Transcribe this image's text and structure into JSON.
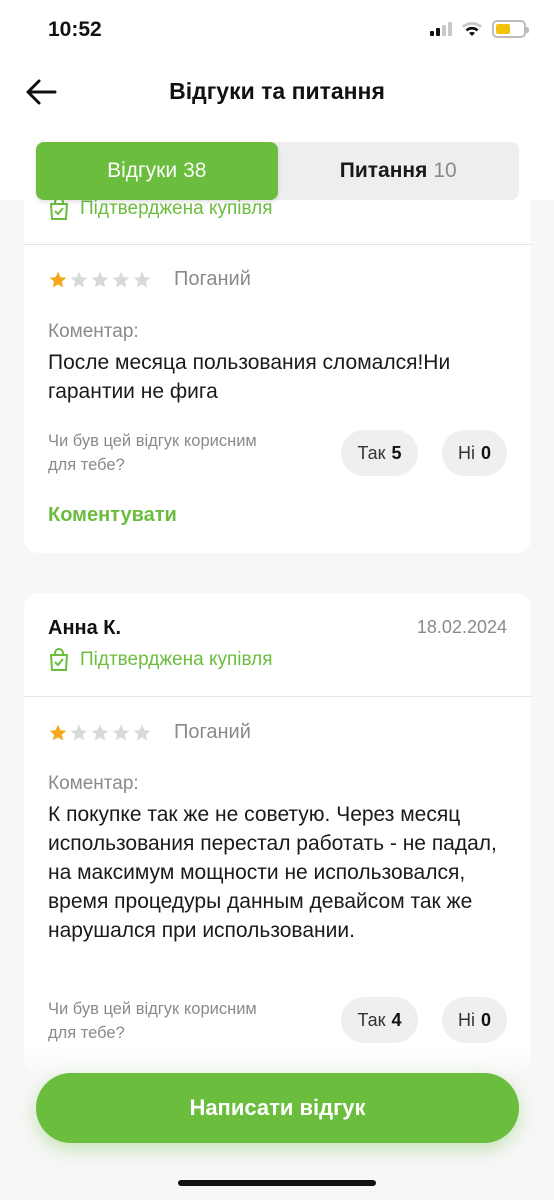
{
  "status": {
    "time": "10:52"
  },
  "header": {
    "title": "Відгуки та питання",
    "tabs": [
      {
        "label": "Відгуки",
        "count": "38",
        "active": true
      },
      {
        "label": "Питання",
        "count": "10",
        "active": false
      }
    ]
  },
  "reviews": [
    {
      "verified_label": "Підтверджена купівля",
      "rating": 1,
      "rating_label": "Поганий",
      "comment_label": "Коментар:",
      "comment": "После месяца пользования сломался!Ни гарантии не фига",
      "helpful_question": "Чи був цей відгук корисним для тебе?",
      "yes_label": "Так",
      "yes_count": "5",
      "no_label": "Ні",
      "no_count": "0",
      "comment_action": "Коментувати"
    },
    {
      "author": "Анна К.",
      "date": "18.02.2024",
      "verified_label": "Підтверджена купівля",
      "rating": 1,
      "rating_label": "Поганий",
      "comment_label": "Коментар:",
      "comment": "К покупке так же не советую. Через месяц использования перестал работать - не падал, на максимум мощности не использовался, время процедуры данным девайсом так же нарушался при использовании.",
      "helpful_question": "Чи був цей відгук корисним для тебе?",
      "yes_label": "Так",
      "yes_count": "4",
      "no_label": "Ні",
      "no_count": "0"
    }
  ],
  "actions": {
    "write_review": "Написати відгук"
  },
  "colors": {
    "accent": "#6bbd3d",
    "star": "#f4a81d",
    "star_empty": "#d9d9d9"
  }
}
